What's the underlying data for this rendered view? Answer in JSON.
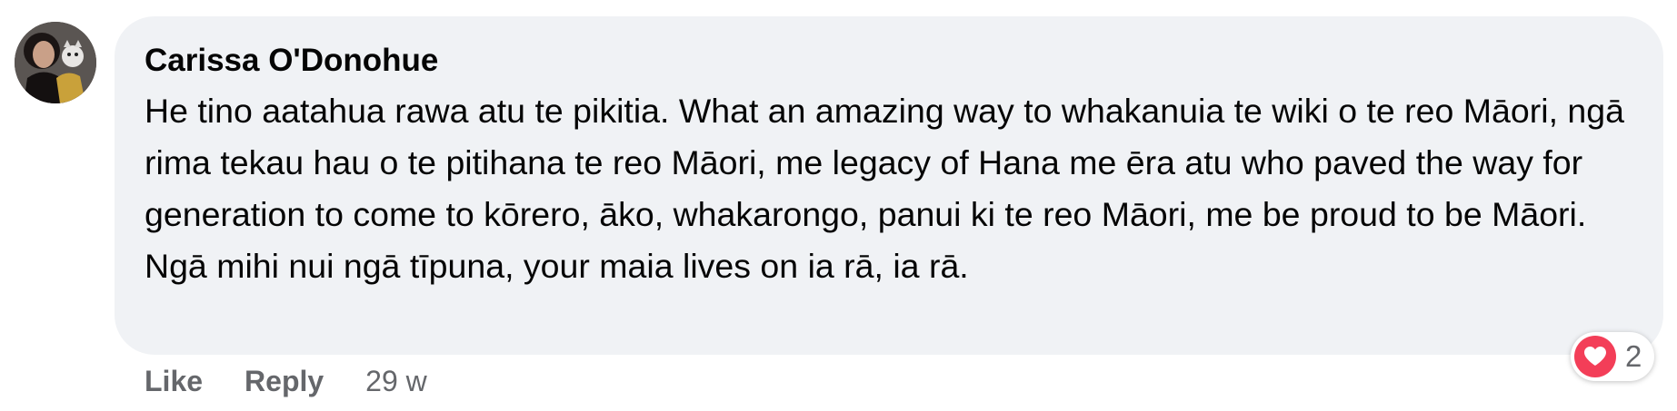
{
  "comment": {
    "author": "Carissa O'Donohue",
    "text": "He tino aatahua rawa atu te pikitia. What an amazing way to whakanuia te wiki o te reo Māori, ngā rima tekau hau o te pitihana te reo Māori, me legacy of Hana me ēra atu who paved the way for generation to come to kōrero, āko, whakarongo, panui ki te reo Māori, me be proud to be Māori. Ngā mihi nui ngā tīpuna, your maia lives on ia rā, ia rā.",
    "like_label": "Like",
    "reply_label": "Reply",
    "timestamp": "29 w",
    "reaction": {
      "icon": "heart-icon",
      "count": "2",
      "color": "#f33e58"
    }
  }
}
